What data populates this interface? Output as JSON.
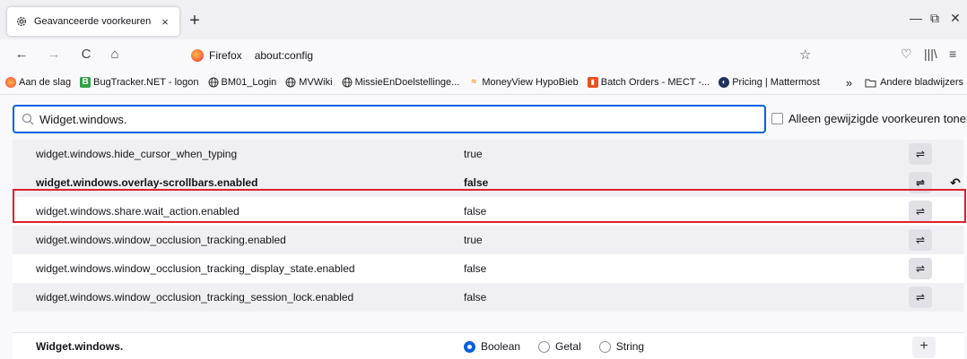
{
  "tab": {
    "title": "Geavanceerde voorkeuren",
    "close": "×",
    "new_tab": "+"
  },
  "window": {
    "minimize": "—",
    "restore": "⧉",
    "close": "✕"
  },
  "nav": {
    "back": "←",
    "forward": "→",
    "reload": "C",
    "home": "⌂",
    "identity_label": "Firefox",
    "url": "about:config",
    "star": "☆",
    "pocket": "♡",
    "library": "|||\\",
    "menu": "≡"
  },
  "bookmarks": {
    "items": [
      {
        "label": "Aan de slag",
        "icon": "firefox-icon"
      },
      {
        "label": "BugTracker.NET - logon",
        "icon": "b-icon"
      },
      {
        "label": "BM01_Login",
        "icon": "globe-icon"
      },
      {
        "label": "MVWiki",
        "icon": "globe-icon"
      },
      {
        "label": "MissieEnDoelstellinge...",
        "icon": "globe-icon"
      },
      {
        "label": "MoneyView HypoBieb",
        "icon": "moneyview-icon"
      },
      {
        "label": "Batch Orders - MECT -...",
        "icon": "batch-icon"
      },
      {
        "label": "Pricing | Mattermost",
        "icon": "mattermost-icon"
      }
    ],
    "overflow": "»",
    "other_folder": "Andere bladwijzers"
  },
  "search": {
    "value": "Widget.windows."
  },
  "modified_only_label": "Alleen gewijzigde voorkeuren tonen",
  "prefs": [
    {
      "name": "widget.windows.hide_cursor_when_typing",
      "value": "true",
      "modified": false
    },
    {
      "name": "widget.windows.overlay-scrollbars.enabled",
      "value": "false",
      "modified": true
    },
    {
      "name": "widget.windows.share.wait_action.enabled",
      "value": "false",
      "modified": false
    },
    {
      "name": "widget.windows.window_occlusion_tracking.enabled",
      "value": "true",
      "modified": false
    },
    {
      "name": "widget.windows.window_occlusion_tracking_display_state.enabled",
      "value": "false",
      "modified": false
    },
    {
      "name": "widget.windows.window_occlusion_tracking_session_lock.enabled",
      "value": "false",
      "modified": false
    }
  ],
  "toggle_glyph": "⇌",
  "reset_glyph": "↶",
  "new_pref": {
    "name": "Widget.windows.",
    "types": [
      "Boolean",
      "Getal",
      "String"
    ],
    "selected": "Boolean",
    "add": "+"
  },
  "colors": {
    "accent": "#0061e0",
    "highlight_border": "#e0202b"
  }
}
